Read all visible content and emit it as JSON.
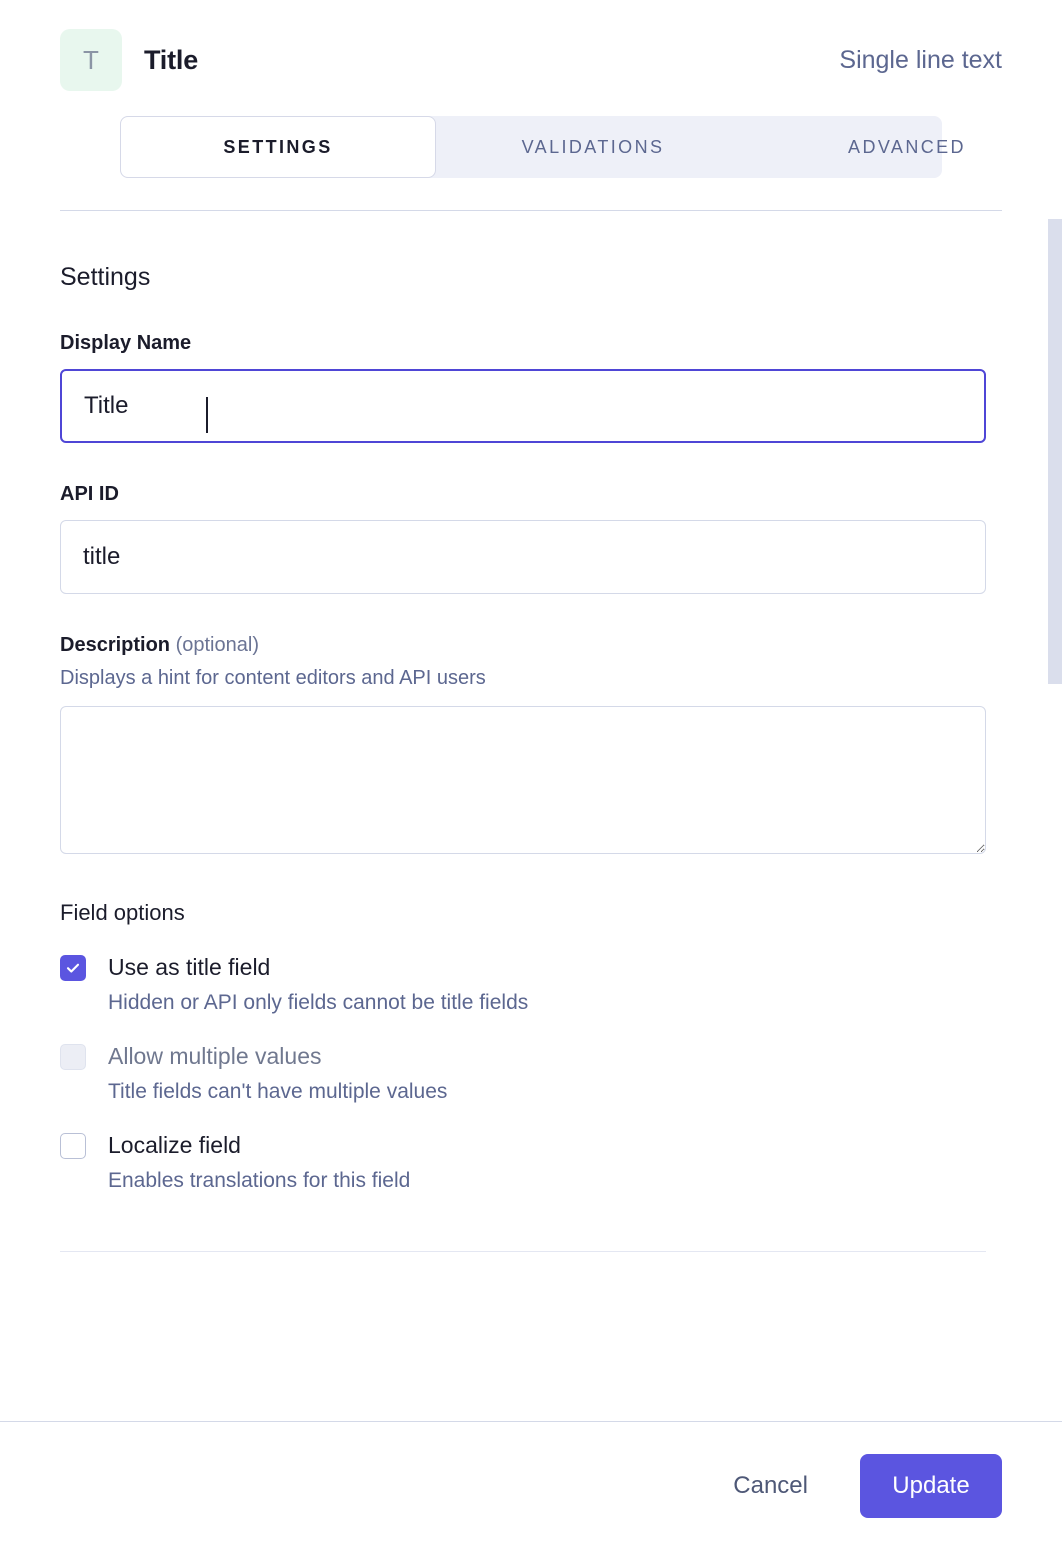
{
  "header": {
    "badge_letter": "T",
    "badge_icon": "text-field-icon",
    "field_title": "Title",
    "field_type": "Single line text"
  },
  "tabs": [
    {
      "label": "SETTINGS",
      "active": true
    },
    {
      "label": "VALIDATIONS",
      "active": false
    },
    {
      "label": "ADVANCED",
      "active": false
    }
  ],
  "settings": {
    "section_title": "Settings",
    "display_name": {
      "label": "Display Name",
      "value": "Title",
      "placeholder": "",
      "focused": true
    },
    "api_id": {
      "label": "API ID",
      "value": "title",
      "placeholder": ""
    },
    "description": {
      "label": "Description",
      "optional_suffix": "(optional)",
      "hint": "Displays a hint for content editors and API users",
      "value": "",
      "placeholder": ""
    },
    "field_options_title": "Field options",
    "options": [
      {
        "label": "Use as title field",
        "description": "Hidden or API only fields cannot be title fields",
        "checked": true,
        "disabled": false
      },
      {
        "label": "Allow multiple values",
        "description": "Title fields can't have multiple values",
        "checked": false,
        "disabled": true
      },
      {
        "label": "Localize field",
        "description": "Enables translations for this field",
        "checked": false,
        "disabled": false
      }
    ]
  },
  "footer": {
    "cancel_label": "Cancel",
    "update_label": "Update"
  },
  "colors": {
    "accent": "#5b55e0",
    "focus_border": "#4f46d6",
    "badge_bg": "#e8f7ee",
    "muted_text": "#5c6790",
    "dark_text": "#1b1c2b",
    "tabs_bg": "#eef0f8",
    "border": "#d4d9e8",
    "scrollbar_thumb": "#dadeec"
  }
}
